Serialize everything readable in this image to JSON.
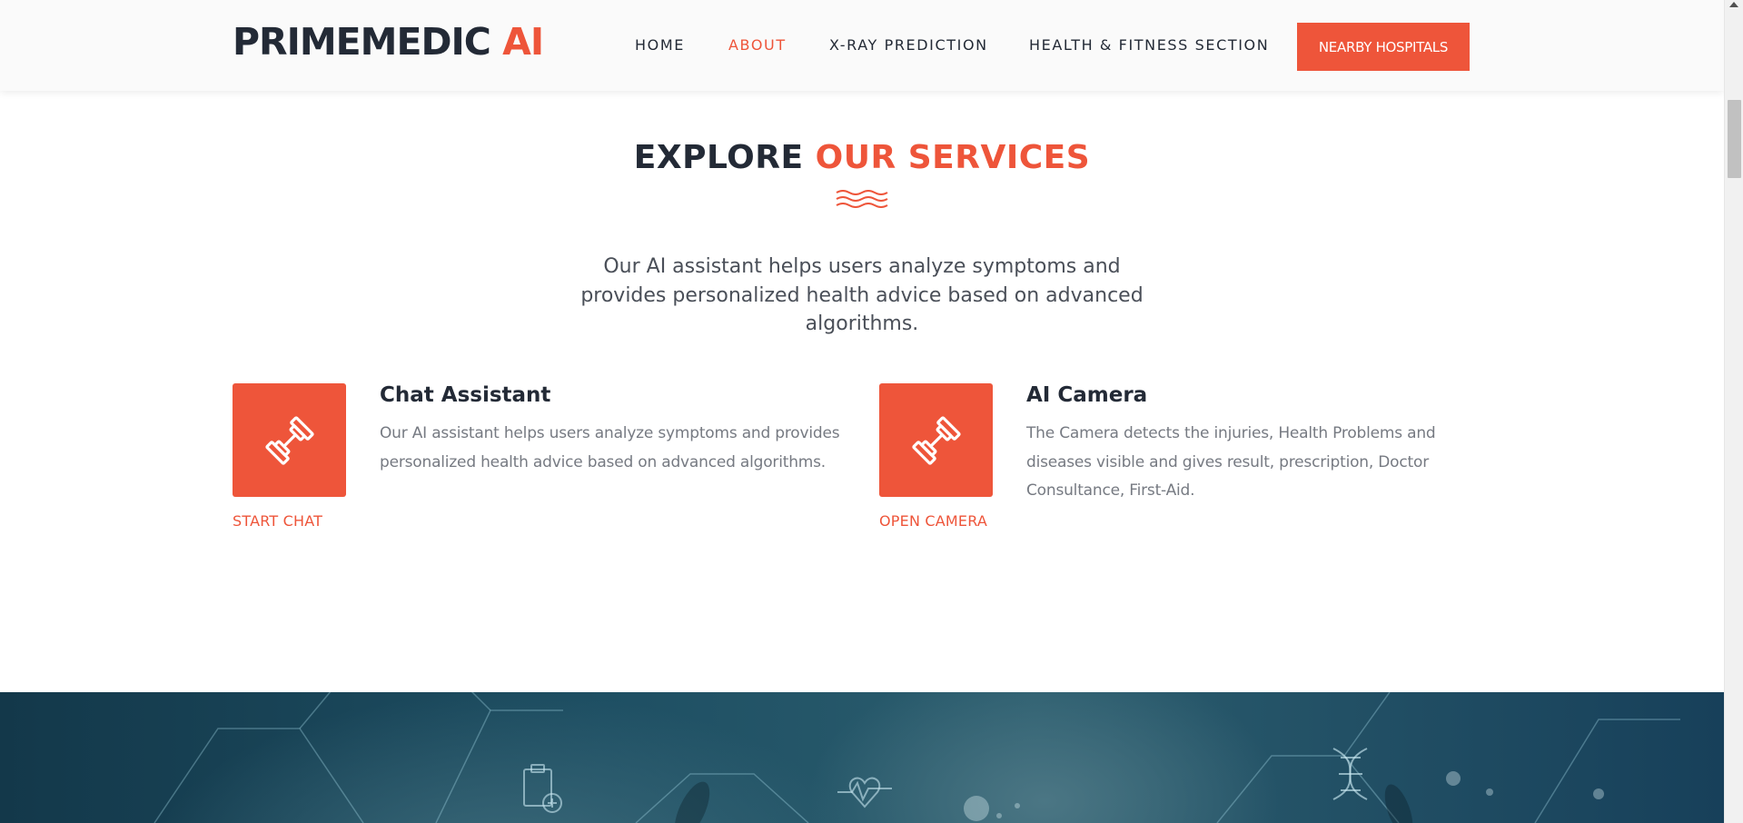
{
  "brand": {
    "name": "PRIMEMEDIC",
    "accent": "AI"
  },
  "nav": {
    "items": [
      {
        "label": "HOME"
      },
      {
        "label": "ABOUT",
        "active": true
      },
      {
        "label": "X-RAY PREDICTION"
      },
      {
        "label": "HEALTH & FITNESS SECTION"
      }
    ],
    "cta_label": "NEARBY HOSPITALS"
  },
  "services": {
    "title_plain": "EXPLORE",
    "title_accent": "OUR SERVICES",
    "intro": "Our AI assistant helps users analyze symptoms and provides personalized health advice based on advanced algorithms.",
    "items": [
      {
        "title": "Chat Assistant",
        "description": "Our AI assistant helps users analyze symptoms and provides personalized health advice based on advanced algorithms.",
        "link_label": "START CHAT",
        "icon": "dumbbell-icon"
      },
      {
        "title": "AI Camera",
        "description": "The Camera detects the injuries, Health Problems and diseases visible and gives result, prescription, Doctor Consultance, First-Aid.",
        "link_label": "OPEN CAMERA",
        "icon": "dumbbell-icon"
      }
    ]
  },
  "banner": {
    "icons": [
      "medical-clipboard-icon",
      "heartbeat-icon",
      "dna-icon"
    ]
  },
  "colors": {
    "accent": "#ee553a",
    "dark": "#232a36",
    "body_text": "#767a82",
    "header_bg": "#fafafa"
  }
}
